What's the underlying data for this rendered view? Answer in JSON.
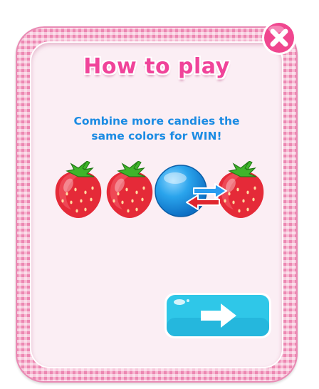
{
  "dialog": {
    "title": "How to play",
    "instruction_line1": "Combine more candies the",
    "instruction_line2": "same colors for WIN!"
  },
  "candies": [
    {
      "kind": "strawberry",
      "icon": "strawberry-icon"
    },
    {
      "kind": "strawberry",
      "icon": "strawberry-icon"
    },
    {
      "kind": "blue-candy",
      "icon": "blue-ball-candy-icon"
    },
    {
      "kind": "strawberry",
      "icon": "strawberry-icon"
    }
  ],
  "swap_indicator": {
    "icon": "swap-arrows-icon"
  },
  "buttons": {
    "close_icon": "close-icon",
    "next_icon": "arrow-right-icon"
  },
  "colors": {
    "title_pink": "#f0449a",
    "text_blue": "#1b8be3",
    "panel_bg": "#fbeef4",
    "frame_pink": "#f7b9d2",
    "button_cyan": "#2fc7e8",
    "close_pink": "#f0468f"
  }
}
